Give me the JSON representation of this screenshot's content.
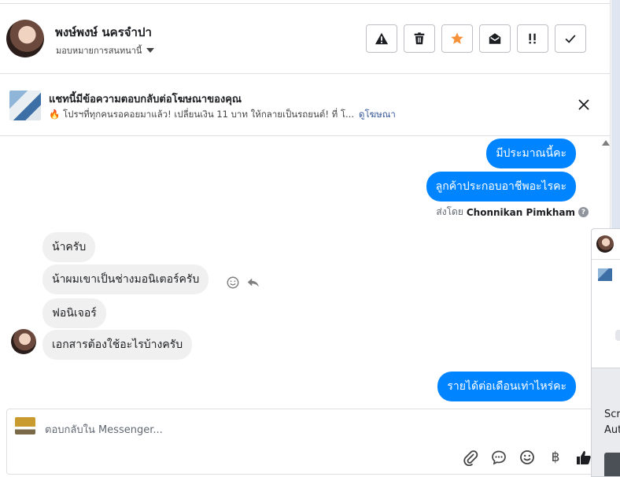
{
  "header": {
    "contact_name": "พงษ์พงษ์ นครจำปา",
    "assign_label": "มอบหมายการสนทนานี้",
    "actions": [
      {
        "name": "spam-button",
        "icon": "warning-icon"
      },
      {
        "name": "delete-button",
        "icon": "trash-icon"
      },
      {
        "name": "star-button",
        "icon": "star-icon"
      },
      {
        "name": "mark-unread-button",
        "icon": "envelope-open-icon"
      },
      {
        "name": "follow-up-button",
        "icon": "exclamation-icon"
      },
      {
        "name": "done-button",
        "icon": "check-icon"
      }
    ]
  },
  "ad": {
    "title": "แชทนี้มีข้อความตอบกลับต่อโฆษณาของคุณ",
    "subtitle": "🔥 โปรฯที่ทุกคนรอคอยมาแล้ว! เปลี่ยนเงิน 11 บาท ให้กลายเป็นรถยนต์! ที่ โ...",
    "link": "ดูโฆษณา"
  },
  "messages": {
    "out": [
      "มีประมาณนี้คะ",
      "ลูกค้าประกอบอาชีพอะไรคะ",
      "รายได้ต่อเดือนเท่าไหร่คะ"
    ],
    "sent_by_label": "ส่งโดย",
    "sent_by_name": "Chonnikan Pimkham",
    "in": [
      "น้าครับ",
      "น้าผมเขาเป็นช่างมอนิเตอร์ครับ",
      "ฟอนิเจอร์",
      "เอกสารต้องใช้อะไรบ้างครับ"
    ]
  },
  "composer": {
    "placeholder": "ตอบกลับใน Messenger...",
    "currency_symbol": "฿"
  },
  "side_window": {
    "text_1": "Scr",
    "text_2": "Aut"
  },
  "colors": {
    "accent": "#0084ff",
    "star": "#f7923a"
  }
}
